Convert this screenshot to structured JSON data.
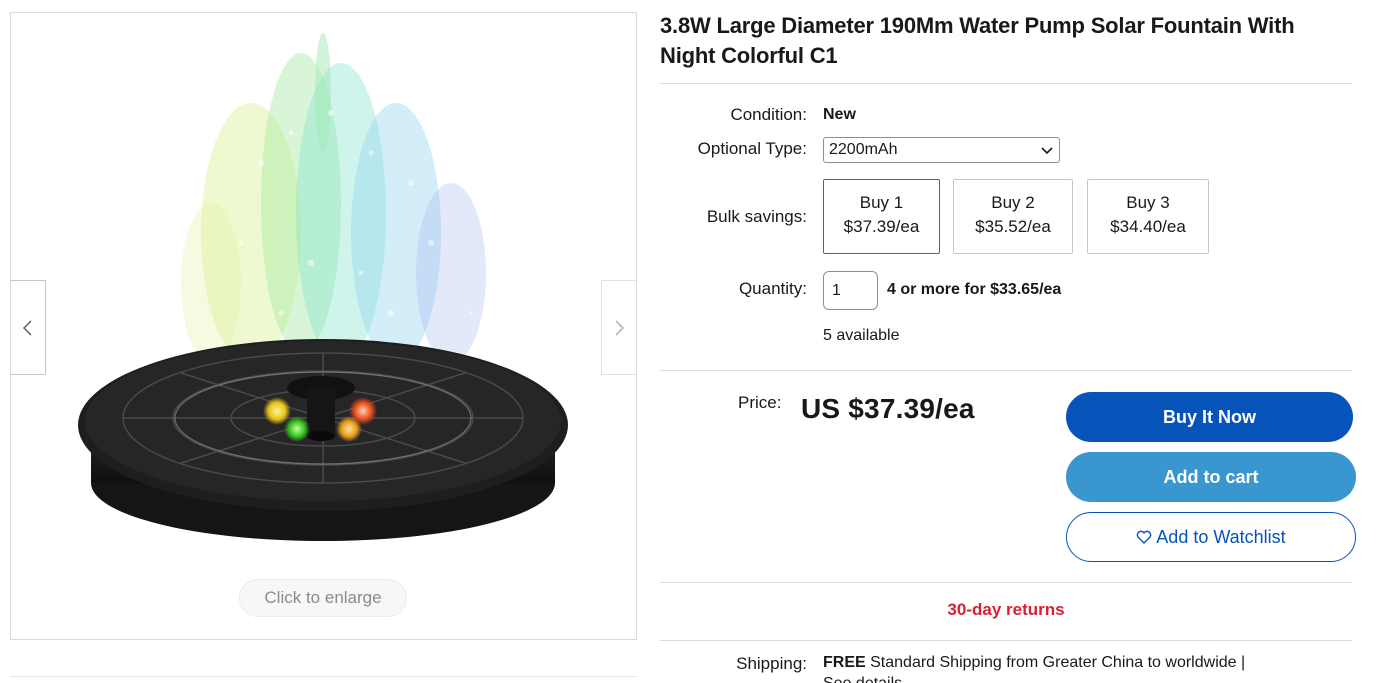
{
  "gallery": {
    "enlarge_label": "Click to enlarge",
    "prev_icon": "chevron-left-icon",
    "next_icon": "chevron-right-icon"
  },
  "product": {
    "title": "3.8W Large Diameter 190Mm Water Pump Solar Fountain With Night Colorful C1"
  },
  "details": {
    "condition_label": "Condition:",
    "condition_value": "New",
    "optional_type_label": "Optional Type:",
    "optional_type_value": "2200mAh",
    "bulk_label": "Bulk savings:",
    "bulk_options": [
      {
        "qty": "Buy 1",
        "price": "$37.39/ea"
      },
      {
        "qty": "Buy 2",
        "price": "$35.52/ea"
      },
      {
        "qty": "Buy 3",
        "price": "$34.40/ea"
      }
    ],
    "quantity_label": "Quantity:",
    "quantity_value": "1",
    "quantity_deal": "4 or more for $33.65/ea",
    "available": "5 available"
  },
  "pricing": {
    "price_label": "Price:",
    "price_value": "US $37.39/ea"
  },
  "actions": {
    "buy_now": "Buy It Now",
    "add_to_cart": "Add to cart",
    "watchlist": "Add to Watchlist"
  },
  "returns": "30-day returns",
  "shipping": {
    "label": "Shipping:",
    "free": "FREE",
    "text": "Standard Shipping from Greater China to worldwide |",
    "see_details": "See details"
  },
  "colors": {
    "buy_now_bg": "#0654ba",
    "add_to_cart_bg": "#3a96ce",
    "returns_red": "#dd1e31"
  }
}
